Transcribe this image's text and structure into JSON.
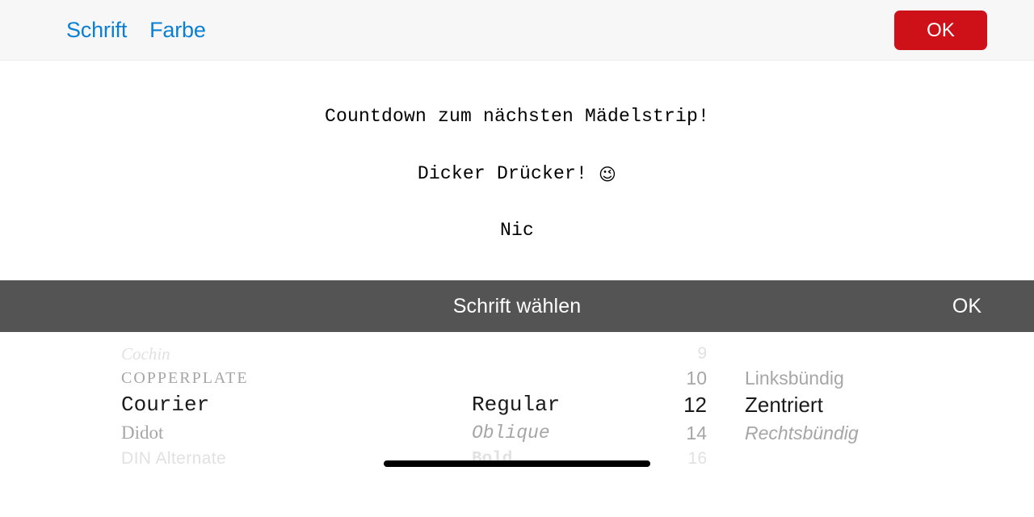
{
  "navbar": {
    "links": [
      {
        "label": "Schrift"
      },
      {
        "label": "Farbe"
      }
    ],
    "ok_label": "OK",
    "ok_color": "#ce1018",
    "link_color": "#0b7fd4",
    "background": "#f7f7f7"
  },
  "document": {
    "lines": [
      "Countdown zum nächsten Mädelstrip!",
      "Dicker Drücker! ",
      "Nic"
    ],
    "emoji": "😉",
    "font": "Courier",
    "alignment": "Zentriert",
    "text_color": "#000000"
  },
  "picker": {
    "title": "Schrift wählen",
    "ok_label": "OK",
    "toolbar_background": "#545454",
    "selection_background": "#ececec",
    "columns": {
      "font": {
        "name": "font-family",
        "selected": "Courier",
        "items": [
          {
            "label": "Cochin"
          },
          {
            "label": "Copperplate"
          },
          {
            "label": "Courier"
          },
          {
            "label": "Didot"
          },
          {
            "label": "DIN Alternate"
          }
        ]
      },
      "style": {
        "name": "font-style",
        "selected": "Regular",
        "items": [
          {
            "label": ""
          },
          {
            "label": ""
          },
          {
            "label": "Regular"
          },
          {
            "label": "Oblique"
          },
          {
            "label": "Bold"
          }
        ]
      },
      "size": {
        "name": "font-size",
        "selected": "12",
        "items": [
          {
            "label": "9"
          },
          {
            "label": "10"
          },
          {
            "label": "12"
          },
          {
            "label": "14"
          },
          {
            "label": "16"
          }
        ]
      },
      "align": {
        "name": "text-alignment",
        "selected": "Zentriert",
        "items": [
          {
            "label": ""
          },
          {
            "label": "Linksbündig"
          },
          {
            "label": "Zentriert"
          },
          {
            "label": "Rechtsbündig"
          },
          {
            "label": ""
          }
        ]
      }
    }
  }
}
